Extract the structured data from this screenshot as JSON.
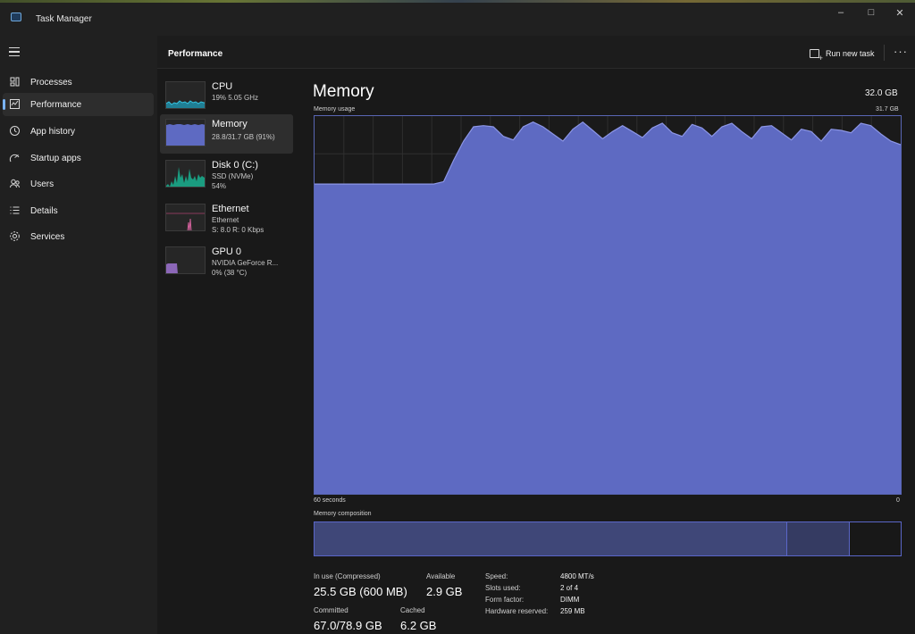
{
  "window": {
    "title": "Task Manager"
  },
  "nav": {
    "items": [
      {
        "label": "Processes",
        "icon": "processes-icon"
      },
      {
        "label": "Performance",
        "icon": "performance-icon"
      },
      {
        "label": "App history",
        "icon": "history-icon"
      },
      {
        "label": "Startup apps",
        "icon": "startup-icon"
      },
      {
        "label": "Users",
        "icon": "users-icon"
      },
      {
        "label": "Details",
        "icon": "details-icon"
      },
      {
        "label": "Services",
        "icon": "services-icon"
      }
    ],
    "active": "Performance"
  },
  "header": {
    "title": "Performance",
    "run_new_task": "Run new task",
    "more": "···"
  },
  "resources": [
    {
      "name": "CPU",
      "lines": [
        "19%  5.05 GHz"
      ],
      "color": "#27a9c6"
    },
    {
      "name": "Memory",
      "lines": [
        "28.8/31.7 GB (91%)"
      ],
      "color": "#7b86d6"
    },
    {
      "name": "Disk 0 (C:)",
      "lines": [
        "SSD (NVMe)",
        "54%"
      ],
      "color": "#1fae8f"
    },
    {
      "name": "Ethernet",
      "lines": [
        "Ethernet",
        "S: 8.0  R: 0 Kbps"
      ],
      "color": "#c25a87"
    },
    {
      "name": "GPU 0",
      "lines": [
        "NVIDIA GeForce R...",
        "0%  (38 °C)"
      ],
      "color": "#9b6fc9"
    }
  ],
  "memory": {
    "title": "Memory",
    "total": "32.0 GB",
    "usage_label": "Memory usage",
    "usage_max": "31.7 GB",
    "axis_left": "60 seconds",
    "axis_right": "0",
    "composition_label": "Memory composition",
    "colors": {
      "fill": "#5e6ac2",
      "line": "#8c96e6",
      "grid": "#2f2f2f"
    }
  },
  "chart_data": {
    "type": "area",
    "title": "Memory usage",
    "ylim": [
      0,
      31.7
    ],
    "x_label_left": "60 seconds",
    "x_label_right": "0",
    "values": [
      26.0,
      26.0,
      26.0,
      26.0,
      26.0,
      26.0,
      26.0,
      26.0,
      26.0,
      26.0,
      26.0,
      26.0,
      26.0,
      26.2,
      28.0,
      29.6,
      30.8,
      30.9,
      30.8,
      30.0,
      29.7,
      30.8,
      31.2,
      30.8,
      30.2,
      29.6,
      30.6,
      31.2,
      30.5,
      29.8,
      30.4,
      30.9,
      30.4,
      29.9,
      30.7,
      31.1,
      30.3,
      30.0,
      31.0,
      30.7,
      30.0,
      30.8,
      31.1,
      30.4,
      29.8,
      30.8,
      30.9,
      30.3,
      29.7,
      30.6,
      30.4,
      29.6,
      30.6,
      30.5,
      30.3,
      31.1,
      30.9,
      30.2,
      29.6,
      29.3
    ]
  },
  "stats": {
    "in_use_label": "In use (Compressed)",
    "in_use_value": "25.5 GB (600 MB)",
    "available_label": "Available",
    "available_value": "2.9 GB",
    "committed_label": "Committed",
    "committed_value": "67.0/78.9 GB",
    "cached_label": "Cached",
    "cached_value": "6.2 GB",
    "details": [
      {
        "key": "Speed:",
        "value": "4800 MT/s"
      },
      {
        "key": "Slots used:",
        "value": "2 of 4"
      },
      {
        "key": "Form factor:",
        "value": "DIMM"
      },
      {
        "key": "Hardware reserved:",
        "value": "259 MB"
      }
    ]
  }
}
